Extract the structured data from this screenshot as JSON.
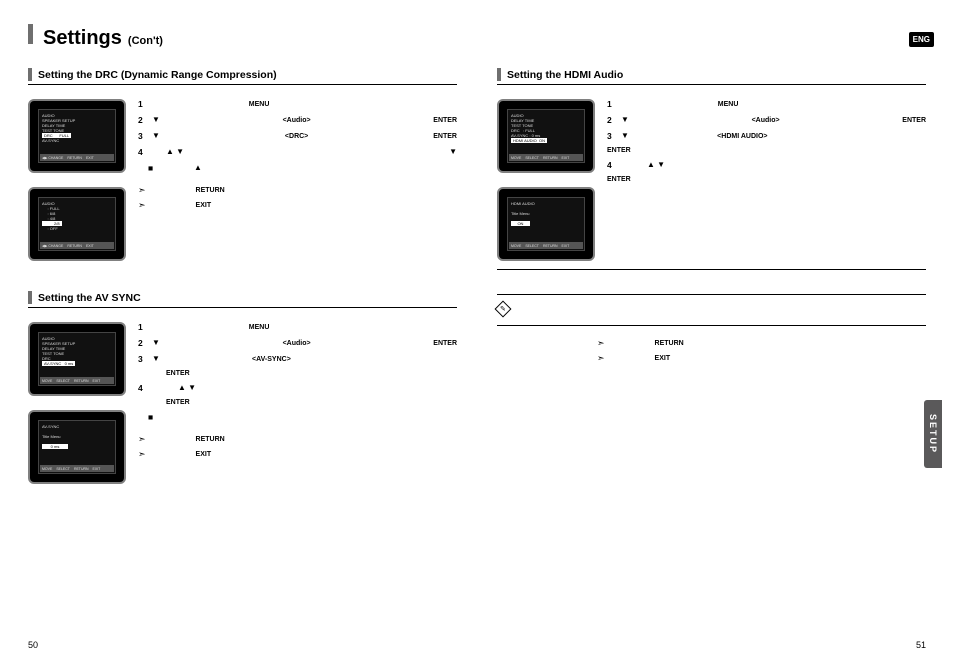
{
  "lang_badge": "ENG",
  "side_tab": "SETUP",
  "title": {
    "main": "Settings",
    "cont": "(Con't)"
  },
  "footer": {
    "left": "50",
    "right": "51"
  },
  "labels": {
    "menu": "MENU",
    "enter": "ENTER",
    "return": "RETURN",
    "exit": "EXIT",
    "audio": "<Audio>"
  },
  "sections": {
    "drc": {
      "heading": "Setting the DRC (Dynamic Range Compression)",
      "tag": "<DRC>"
    },
    "avsync": {
      "heading": "Setting the AV SYNC",
      "tag": "<AV-SYNC>"
    },
    "hdmi": {
      "heading": "Setting the HDMI Audio",
      "tag": "<HDMI AUDIO>"
    }
  },
  "steps": {
    "1": "1",
    "2": "2",
    "3": "3",
    "4": "4"
  }
}
